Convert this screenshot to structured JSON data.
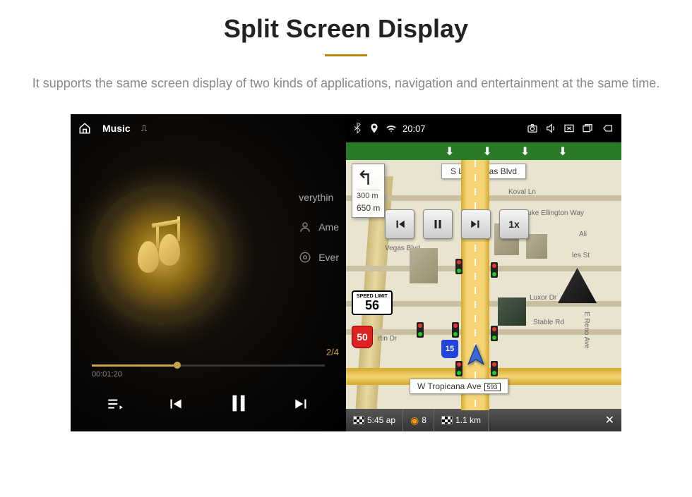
{
  "header": {
    "title": "Split Screen Display",
    "desc": "It supports the same screen display of two kinds of applications, navigation and entertainment at the same time."
  },
  "music": {
    "app": "Music",
    "title": "verythin",
    "artist": "Ame",
    "album": "Ever",
    "track_index": "2/4",
    "time_elapsed": "00:01:20",
    "time_total": ""
  },
  "map": {
    "clock": "20:07",
    "street_top": "S Las Vegas Blvd",
    "turn": {
      "dist_small": "300 m",
      "dist_big": "650 m"
    },
    "nav_speed": "1x",
    "speed_limit": {
      "label": "SPEED LIMIT",
      "value": "56"
    },
    "route_us": "50",
    "route_i": "15",
    "street_labels": {
      "koval": "Koval Ln",
      "duke": "Duke Ellington Way",
      "vegas": "Vegas Blvd",
      "ali": "Ali",
      "luxor": "Luxor Dr",
      "stable": "Stable Rd",
      "reno": "E Reno Ave",
      "martin": "rtin Dr",
      "lesst": "les St"
    },
    "street_bottom": {
      "name": "W Tropicana Ave",
      "exit": "593"
    },
    "bottom": {
      "eta": "5:45 ap",
      "mid": "8",
      "dist": "1.1 km",
      "close": "✕"
    }
  }
}
